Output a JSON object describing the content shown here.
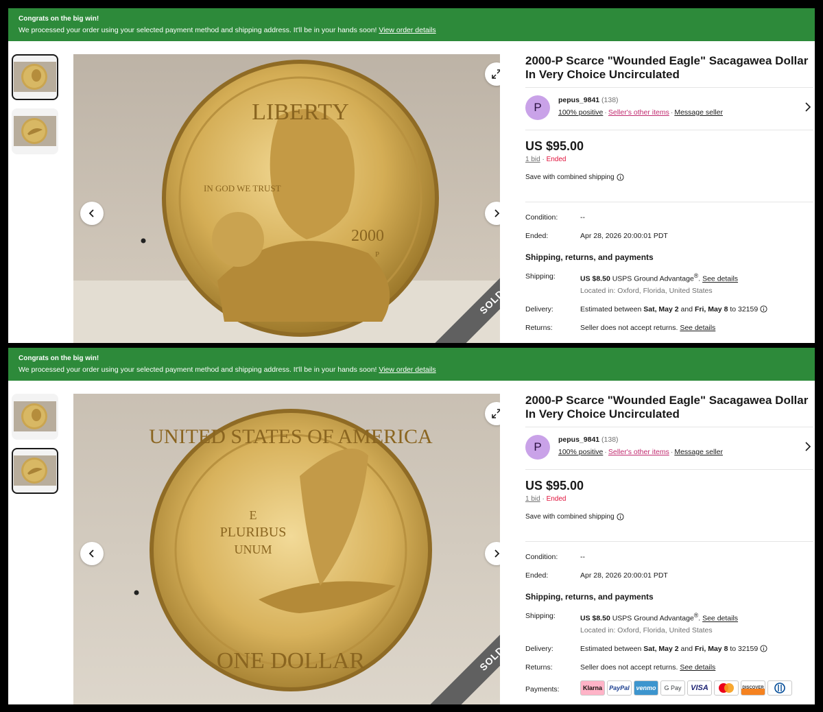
{
  "colors": {
    "banner_bg": "#2d8a3a",
    "ended_red": "#e0103a",
    "link_pink": "#c0296e",
    "avatar_bg": "#c9a2e8",
    "sold_band": "#606060"
  },
  "screens": [
    {
      "banner": {
        "title": "Congrats on the big win!",
        "message": "We processed your order using your selected payment method and shipping address. It'll be in your hands soon!",
        "link": "View order details"
      },
      "gallery": {
        "image": "sacagawea-dollar-obverse-photo",
        "coin_legend": "LIBERTY",
        "coin_motto": "IN GOD WE TRUST",
        "coin_year": "2000",
        "coin_mint": "P",
        "sold_label": "SOLD"
      },
      "listing": {
        "title_line1": "2000-P Scarce \"Wounded Eagle\" Sacagawea Dollar",
        "title_line2": "In Very Choice Uncirculated",
        "seller": {
          "avatar_letter": "P",
          "name": "pepus_9841",
          "feedback_count": "(138)",
          "positive": "100% positive",
          "other_items": "Seller's other items",
          "message": "Message seller"
        },
        "price": "US $95.00",
        "bids": "1 bid",
        "status": "Ended",
        "combined_shipping": "Save with combined shipping",
        "condition": {
          "label": "Condition:",
          "value": "--"
        },
        "ended": {
          "label": "Ended:",
          "value": "Apr 28, 2026 20:00:01 PDT"
        },
        "section_title": "Shipping, returns, and payments",
        "shipping": {
          "label": "Shipping:",
          "amount": "US $8.50",
          "service": "USPS Ground Advantage",
          "reg": "®",
          "link": "See details",
          "location": "Located in: Oxford, Florida, United States"
        },
        "delivery": {
          "label": "Delivery:",
          "prefix": "Estimated between",
          "start": "Sat, May 2",
          "and": "and",
          "end": "Fri, May 8",
          "to": "to 32159"
        },
        "returns": {
          "label": "Returns:",
          "text": "Seller does not accept returns.",
          "link": "See details"
        }
      }
    },
    {
      "banner": {
        "title": "Congrats on the big win!",
        "message": "We processed your order using your selected payment method and shipping address. It'll be in your hands soon!",
        "link": "View order details"
      },
      "gallery": {
        "image": "sacagawea-dollar-reverse-photo",
        "coin_legend": "UNITED STATES OF AMERICA",
        "coin_motto_line1": "E",
        "coin_motto_line2": "PLURIBUS",
        "coin_motto_line3": "UNUM",
        "coin_denomination": "ONE DOLLAR",
        "sold_label": "SOLD"
      },
      "listing": {
        "title_line1": "2000-P Scarce \"Wounded Eagle\" Sacagawea Dollar",
        "title_line2": "In Very Choice Uncirculated",
        "seller": {
          "avatar_letter": "P",
          "name": "pepus_9841",
          "feedback_count": "(138)",
          "positive": "100% positive",
          "other_items": "Seller's other items",
          "message": "Message seller"
        },
        "price": "US $95.00",
        "bids": "1 bid",
        "status": "Ended",
        "combined_shipping": "Save with combined shipping",
        "condition": {
          "label": "Condition:",
          "value": "--"
        },
        "ended": {
          "label": "Ended:",
          "value": "Apr 28, 2026 20:00:01 PDT"
        },
        "section_title": "Shipping, returns, and payments",
        "shipping": {
          "label": "Shipping:",
          "amount": "US $8.50",
          "service": "USPS Ground Advantage",
          "reg": "®",
          "link": "See details",
          "location": "Located in: Oxford, Florida, United States"
        },
        "delivery": {
          "label": "Delivery:",
          "prefix": "Estimated between",
          "start": "Sat, May 2",
          "and": "and",
          "end": "Fri, May 8",
          "to": "to 32159"
        },
        "returns": {
          "label": "Returns:",
          "text": "Seller does not accept returns.",
          "link": "See details"
        },
        "payments": {
          "label": "Payments:",
          "methods": [
            "Klarna",
            "PayPal",
            "venmo",
            "G Pay",
            "VISA",
            "Mastercard",
            "DISCOVER",
            "Diners"
          ]
        }
      }
    }
  ]
}
